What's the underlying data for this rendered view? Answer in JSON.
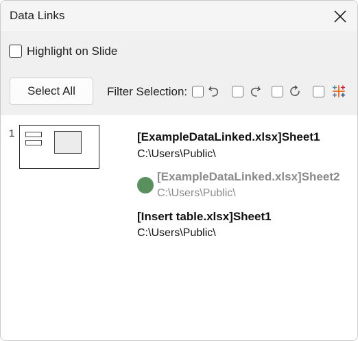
{
  "window": {
    "title": "Data Links"
  },
  "toolbar": {
    "highlight_label": "Highlight on Slide",
    "select_all_label": "Select All",
    "filter_label": "Filter Selection:"
  },
  "slides": [
    {
      "number": "1",
      "links": [
        {
          "name": "[ExampleDataLinked.xlsx]Sheet1",
          "path": "C:\\Users\\Public\\"
        },
        {
          "name": "[ExampleDataLinked.xlsx]Sheet2",
          "path": "C:\\Users\\Public\\"
        },
        {
          "name": "[Insert table.xlsx]Sheet1",
          "path": "C:\\Users\\Public\\"
        }
      ]
    }
  ],
  "colors": {
    "status_dot": "#5a8f5e",
    "dimmed_text": "#8a8a8a"
  }
}
